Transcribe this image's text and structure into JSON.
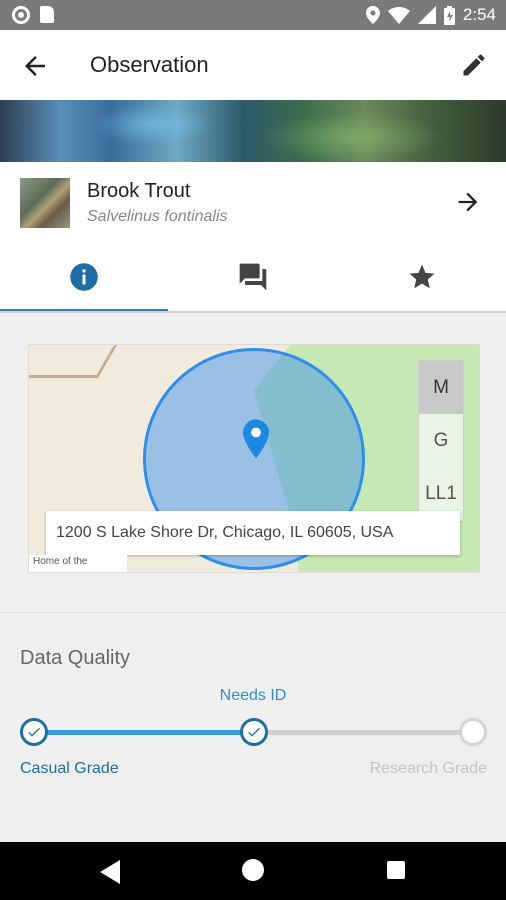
{
  "status_bar": {
    "time": "2:54"
  },
  "app_bar": {
    "title": "Observation",
    "back_icon": "arrow-back-icon",
    "edit_icon": "pencil-icon"
  },
  "species": {
    "common_name": "Brook Trout",
    "scientific_name": "Salvelinus fontinalis"
  },
  "tabs": [
    {
      "icon": "info-icon",
      "active": true
    },
    {
      "icon": "comments-icon",
      "active": false
    },
    {
      "icon": "star-icon",
      "active": false
    }
  ],
  "map": {
    "layers": [
      "M",
      "G",
      "LL1"
    ],
    "selected_layer": "M",
    "address": "1200 S Lake Shore Dr, Chicago, IL 60605, USA",
    "mini_caption": "Home of the"
  },
  "data_quality": {
    "title": "Data Quality",
    "current": "Needs ID",
    "stages": [
      "Casual Grade",
      "Needs ID",
      "Research Grade"
    ],
    "accent": "#2d8fd0"
  }
}
